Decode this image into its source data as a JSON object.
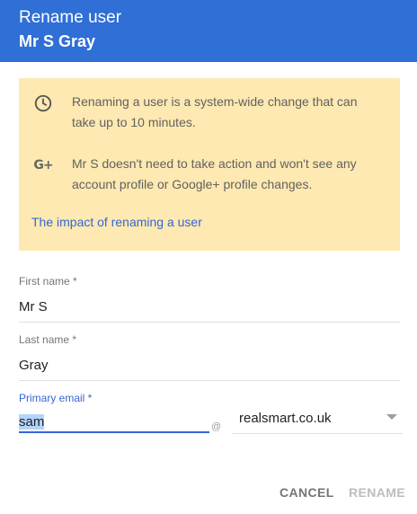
{
  "dialog": {
    "title": "Rename user",
    "subtitle": "Mr S Gray",
    "header_color": "#2f6fd6"
  },
  "notice": {
    "items": [
      {
        "icon": "clock-icon",
        "text": "Renaming a user is a system-wide change that can take up to 10 minutes."
      },
      {
        "icon": "google-plus-icon",
        "icon_text": "G+",
        "text": "Mr S doesn't need to take action and won't see any account profile or Google+ profile changes."
      }
    ],
    "link": "The impact of renaming a user",
    "background": "#fde9b1"
  },
  "form": {
    "first_name": {
      "label": "First name *",
      "value": "Mr S"
    },
    "last_name": {
      "label": "Last name *",
      "value": "Gray"
    },
    "primary_email": {
      "label": "Primary email *",
      "value": "sam",
      "at": "@",
      "domain": "realsmart.co.uk"
    }
  },
  "actions": {
    "cancel": "CANCEL",
    "rename": "RENAME"
  }
}
